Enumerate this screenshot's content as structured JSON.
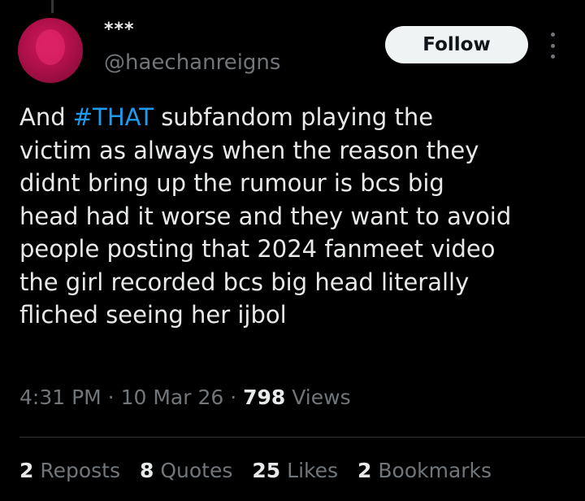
{
  "author": {
    "display_name": "***",
    "handle": "@haechanreigns"
  },
  "actions": {
    "follow_label": "Follow"
  },
  "tweet": {
    "text_before": "And ",
    "hashtag": "#THAT",
    "text_after": " subfandom playing the\nvictim as always when the reason they\ndidnt bring up the rumour is bcs big\nhead had it worse and they want to avoid\npeople posting that 2024 fanmeet video\nthe girl recorded bcs big head literally\nfliched seeing her ijbol"
  },
  "meta": {
    "time": "4:31 PM",
    "separator1": " · ",
    "date": "10 Mar 26",
    "separator2": " · ",
    "views_count": "798",
    "views_label": " Views"
  },
  "stats": [
    {
      "count": "2",
      "label": " Reposts"
    },
    {
      "count": "8",
      "label": " Quotes"
    },
    {
      "count": "25",
      "label": " Likes"
    },
    {
      "count": "2",
      "label": " Bookmarks"
    }
  ],
  "colors": {
    "background": "#000000",
    "text": "#e7e9ea",
    "secondary": "#71767b",
    "hashtag": "#1d9bf0",
    "follow_bg": "#eff3f4"
  },
  "icons": {
    "more": "more-vertical-icon"
  }
}
